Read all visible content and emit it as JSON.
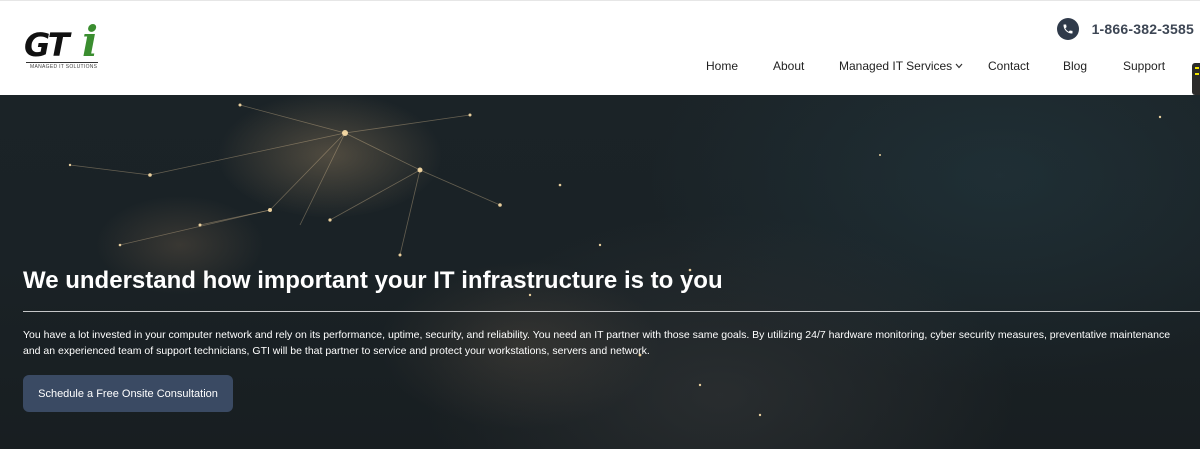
{
  "brand": {
    "logo_mark": "GT",
    "logo_accent": "i",
    "logo_tagline": "MANAGED IT SOLUTIONS",
    "accent_color": "#3a8d2f"
  },
  "header": {
    "phone_icon": "phone-icon",
    "phone_number": "1-866-382-3585"
  },
  "nav": {
    "items": [
      {
        "label": "Home"
      },
      {
        "label": "About"
      },
      {
        "label": "Managed IT Services"
      },
      {
        "label": "Contact"
      },
      {
        "label": "Blog"
      },
      {
        "label": "Support"
      }
    ],
    "dropdown_icon": "chevron-down-icon"
  },
  "hero": {
    "title": "We understand how important your IT infrastructure is to you",
    "description": "You have a lot invested in your computer network and rely on its performance, uptime, security, and reliability. You need an IT partner with those same goals. By utilizing 24/7 hardware monitoring, cyber security measures, preventative maintenance and an experienced team of support technicians, GTI will be that partner to service and protect your workstations, servers and network.",
    "cta_label": "Schedule a Free Onsite Consultation",
    "cta_color": "#3a4a63",
    "background": "night-earth-network-lights"
  }
}
